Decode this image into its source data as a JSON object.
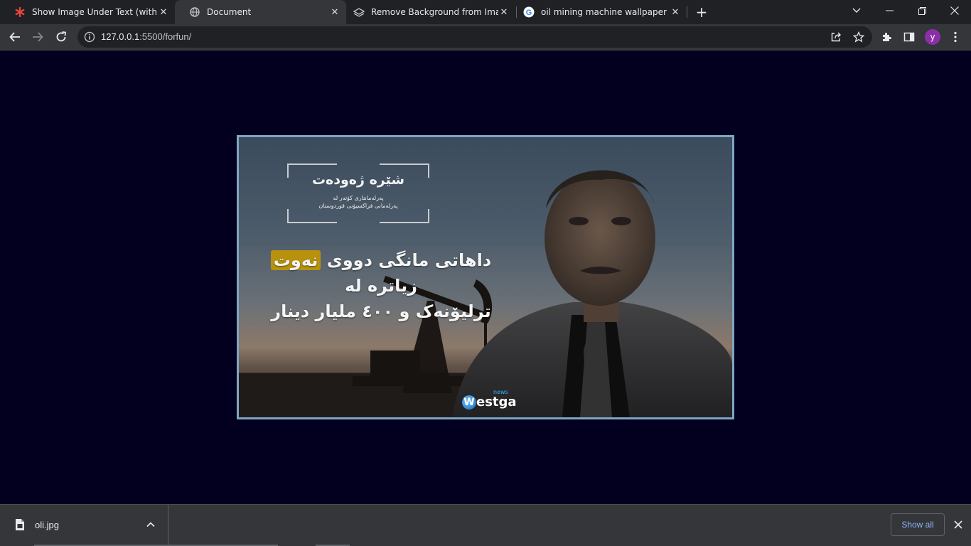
{
  "tabs": [
    {
      "title": "Show Image Under Text (with Ac",
      "favicon": "asterisk-icon"
    },
    {
      "title": "Document",
      "favicon": "globe-icon",
      "active": true
    },
    {
      "title": "Remove Background from Image",
      "favicon": "layers-icon"
    },
    {
      "title": "oil mining machine wallpaper - G",
      "favicon": "google-icon"
    }
  ],
  "toolbar": {
    "url_host": "127.0.0.1",
    "url_rest": ":5500/forfun/",
    "avatar_letter": "y"
  },
  "poster": {
    "name": "شێرە ژەودەت",
    "role_line1": "پەرلەمانتاری کۆتەر لە",
    "role_line2": "پەرلەمانی فراکسیۆنی قوردوستان",
    "headline_line1_before": "داهاتی مانگی دووی",
    "headline_highlight": "نەوت",
    "headline_line2": "زیاترە لە",
    "headline_line3": "ترلیۆنەک و ٤٠٠ ملیار دینار",
    "logo_text": "estga",
    "logo_letter": "W",
    "logo_news": "news"
  },
  "downloads": {
    "file_name": "oli.jpg",
    "show_all": "Show all"
  },
  "colors": {
    "page_bg": "#03001f",
    "highlight": "#b8920f",
    "frame_border": "#7fa6c3",
    "link": "#8ab4f8"
  }
}
